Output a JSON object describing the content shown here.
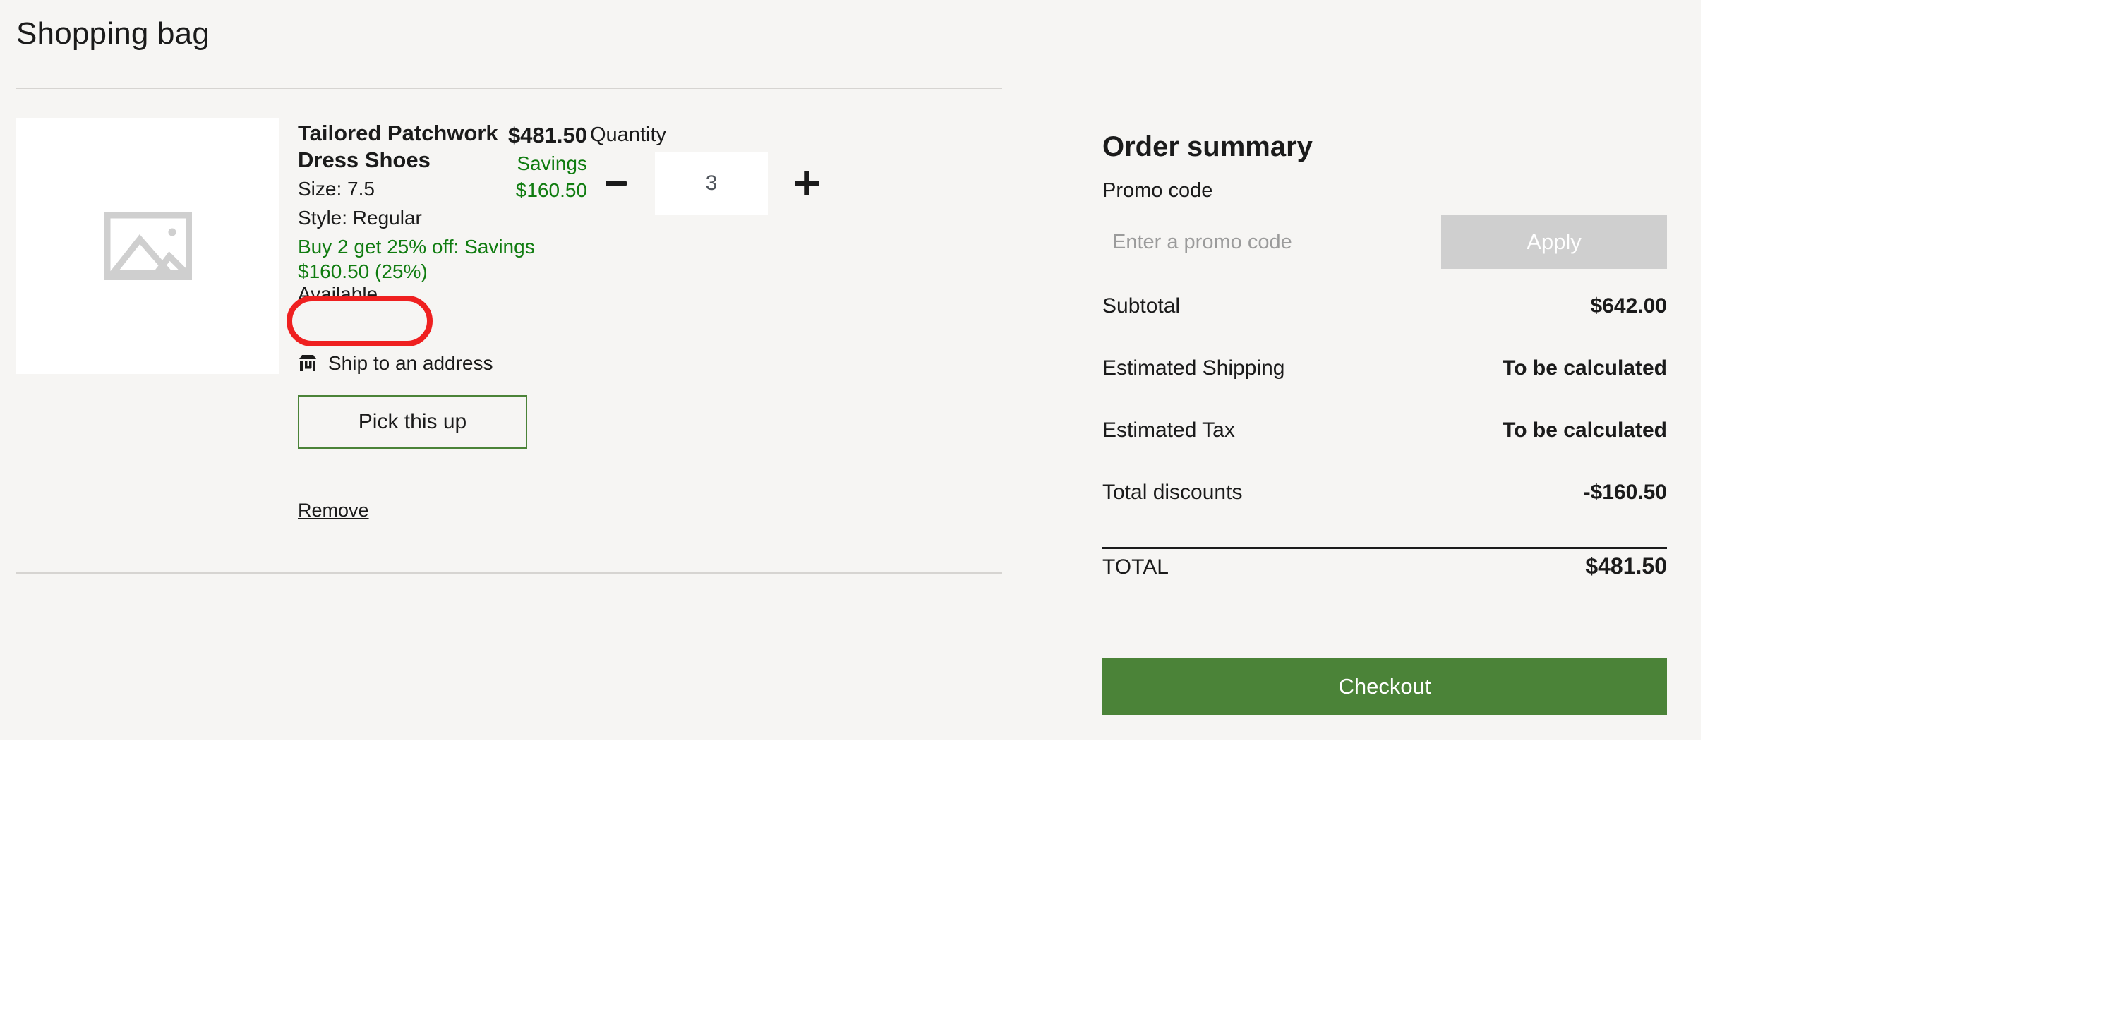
{
  "page": {
    "title": "Shopping bag",
    "background_color": "#f6f5f3",
    "accent_green": "#4b8338",
    "savings_green": "#107c10",
    "annotation_color": "#ef2020"
  },
  "item": {
    "image_placeholder_icon": "broken-image-icon",
    "name": "Tailored Patchwork Dress Shoes",
    "size": "Size: 7.5",
    "style": "Style: Regular",
    "promo": "Buy 2 get 25% off: Savings $160.50 (25%)",
    "availability": "Available",
    "fulfillment_icon": "store-icon",
    "fulfillment_label": "Ship to an address",
    "pickup_label": "Pick this up",
    "remove_label": "Remove",
    "quantity_label": "Quantity",
    "quantity_value": "3",
    "decrease_icon": "minus-icon",
    "increase_icon": "plus-icon",
    "price": "$481.50",
    "savings_label": "Savings",
    "savings_amount": "$160.50"
  },
  "summary": {
    "title": "Order summary",
    "promo_label": "Promo code",
    "promo_placeholder": "Enter a promo code",
    "promo_value": "",
    "apply_label": "Apply",
    "rows": [
      {
        "label": "Subtotal",
        "value": "$642.00"
      },
      {
        "label": "Estimated Shipping",
        "value": "To be calculated"
      },
      {
        "label": "Estimated Tax",
        "value": "To be calculated"
      },
      {
        "label": "Total discounts",
        "value": "-$160.50"
      }
    ],
    "total_label": "TOTAL",
    "total_value": "$481.50",
    "checkout_label": "Checkout"
  }
}
